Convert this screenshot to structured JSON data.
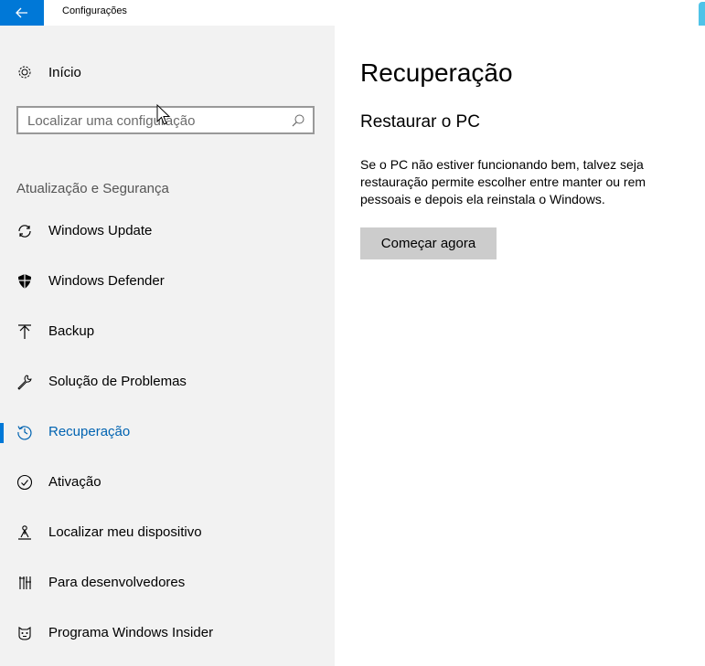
{
  "window": {
    "title": "Configurações",
    "back_icon": "arrow-left-icon"
  },
  "sidebar": {
    "home_label": "Início",
    "search_placeholder": "Localizar uma configuração",
    "section_header": "Atualização e Segurança",
    "items": [
      {
        "label": "Windows Update",
        "icon": "sync-icon"
      },
      {
        "label": "Windows Defender",
        "icon": "shield-icon"
      },
      {
        "label": "Backup",
        "icon": "backup-upload-icon"
      },
      {
        "label": "Solução de Problemas",
        "icon": "wrench-icon"
      },
      {
        "label": "Recuperação",
        "icon": "history-icon",
        "active": true
      },
      {
        "label": "Ativação",
        "icon": "check-circle-icon"
      },
      {
        "label": "Localizar meu dispositivo",
        "icon": "find-device-icon"
      },
      {
        "label": "Para desenvolvedores",
        "icon": "developer-tools-icon"
      },
      {
        "label": "Programa Windows Insider",
        "icon": "insider-icon"
      }
    ]
  },
  "main": {
    "title": "Recuperação",
    "section_title": "Restaurar o PC",
    "description_lines": [
      "Se o PC não estiver funcionando bem, talvez seja",
      "restauração permite escolher entre manter ou rem",
      "pessoais e depois ela reinstala o Windows."
    ],
    "button_label": "Começar agora"
  },
  "colors": {
    "accent": "#0078d7",
    "active_text": "#0063b1",
    "sidebar_bg": "#f2f2f2",
    "button_bg": "#cccccc"
  }
}
